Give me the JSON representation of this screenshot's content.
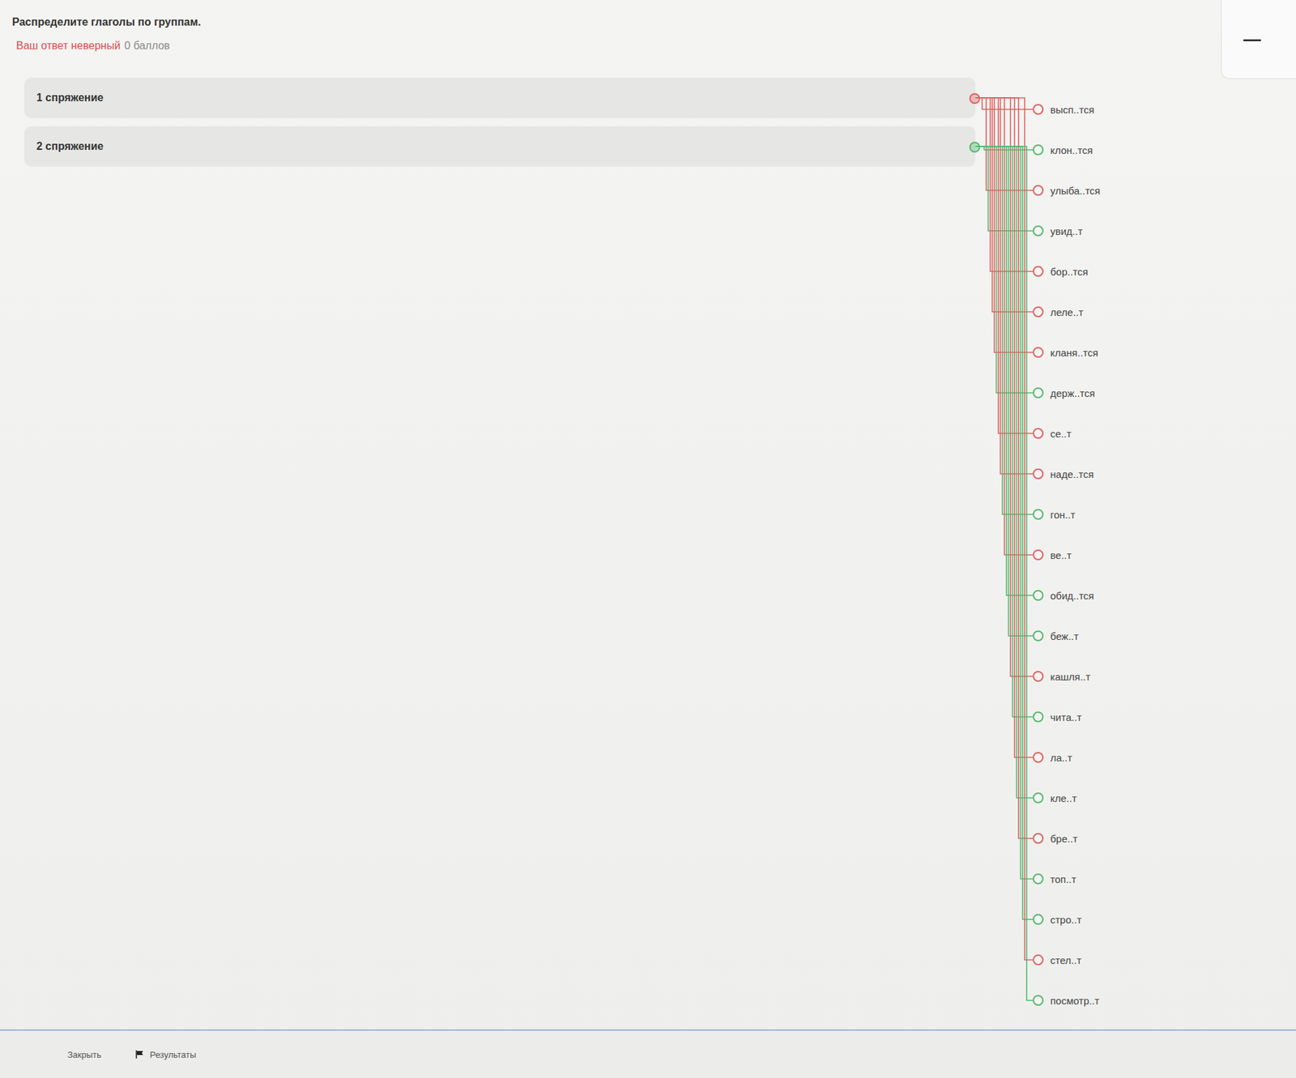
{
  "task": {
    "title": "Распределите глаголы по группам.",
    "result": "Ваш ответ неверный",
    "score": "0 баллов",
    "correct": false
  },
  "minimize_button": "—",
  "groups": [
    {
      "label": "1 спряжение",
      "color": "#e06060"
    },
    {
      "label": "2 спряжение",
      "color": "#52b86c"
    }
  ],
  "verbs": [
    {
      "text": "высп..тся",
      "group": 0
    },
    {
      "text": "клон..тся",
      "group": 1
    },
    {
      "text": "улыба..тся",
      "group": 0
    },
    {
      "text": "увид..т",
      "group": 1
    },
    {
      "text": "бор..тся",
      "group": 0
    },
    {
      "text": "леле..т",
      "group": 0
    },
    {
      "text": "кланя..тся",
      "group": 0
    },
    {
      "text": "держ..тся",
      "group": 1
    },
    {
      "text": "се..т",
      "group": 0
    },
    {
      "text": "наде..тся",
      "group": 0
    },
    {
      "text": "гон..т",
      "group": 1
    },
    {
      "text": "ве..т",
      "group": 0
    },
    {
      "text": "обид..тся",
      "group": 1
    },
    {
      "text": "беж..т",
      "group": 1
    },
    {
      "text": "кашля..т",
      "group": 0
    },
    {
      "text": "чита..т",
      "group": 1
    },
    {
      "text": "ла..т",
      "group": 0
    },
    {
      "text": "кле..т",
      "group": 1
    },
    {
      "text": "бре..т",
      "group": 0
    },
    {
      "text": "топ..т",
      "group": 1
    },
    {
      "text": "стро..т",
      "group": 1
    },
    {
      "text": "стел..т",
      "group": 0
    },
    {
      "text": "посмотр..т",
      "group": 1
    }
  ],
  "footer": {
    "close": "Закрыть",
    "results": "Результаты"
  }
}
